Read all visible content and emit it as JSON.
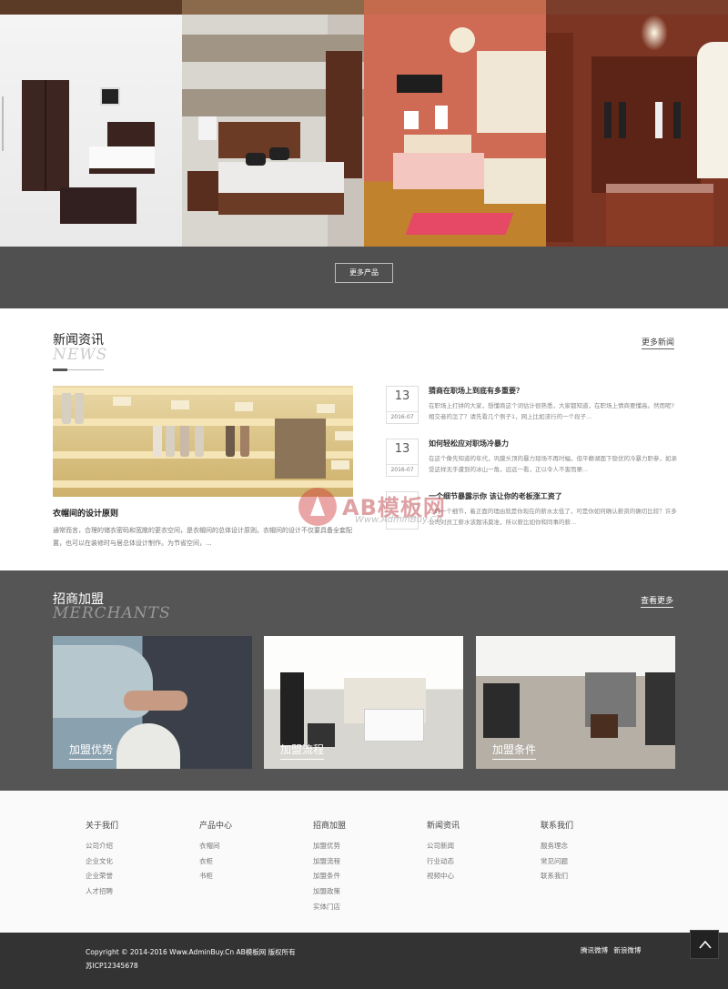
{
  "products": {
    "more_label": "更多产品"
  },
  "news": {
    "title_cn": "新闻资讯",
    "title_en": "NEWS",
    "more_label": "更多新闻",
    "featured": {
      "title": "衣帽间的设计原则",
      "desc": "通常而言，合理的储衣密码和宽敞的更衣空间，是衣帽间的总体设计原则。衣帽间的设计不仅要具备全套配置，也可以在装修时与居总体设计制作。为节省空间，..."
    },
    "items": [
      {
        "day": "13",
        "ym": "2016-07",
        "title": "猜商在职场上到底有多重要？",
        "desc": "在职场上打拼的大家，想懂商这个词估计很熟悉，大家都知道，在职场上情商要懂高。然而呢?相交者的怎了？请先看几个例子1，网上比如流行的一个段子..."
      },
      {
        "day": "13",
        "ym": "2016-07",
        "title": "如何轻松应对职场冷暴力",
        "desc": "在这个像先知道的年代，巩膜头顶的暴力现场不再时幅，但平静湖面下隐伏的冷暴力职参，如承受这样无手遭到的冰山一角，远远一看，正以令人不害而栗..."
      },
      {
        "day": "",
        "ym": "",
        "title": "一个细节暴露示你 该让你的老板涨工资了",
        "desc": "...的一个细节，着正面的理由就是你现在的薪水太低了，可是你如何确认薪资的确切比较？许多公司对员工薪水该题讳莫准，所以薪比如你和同事的薪..."
      }
    ]
  },
  "merchants": {
    "title_cn": "招商加盟",
    "title_en": "MERCHANTS",
    "more_label": "查看更多",
    "cards": [
      "加盟优势",
      "加盟流程",
      "加盟条件"
    ]
  },
  "watermark": {
    "text": "AB模板网",
    "url": "Www.AdminBuy.Cn"
  },
  "footer": {
    "columns": [
      {
        "title": "关于我们",
        "links": [
          "公司介绍",
          "企业文化",
          "企业荣誉",
          "人才招聘"
        ]
      },
      {
        "title": "产品中心",
        "links": [
          "衣帽间",
          "衣柜",
          "书柜"
        ]
      },
      {
        "title": "招商加盟",
        "links": [
          "加盟优势",
          "加盟流程",
          "加盟条件",
          "加盟政策",
          "实体门店"
        ]
      },
      {
        "title": "新闻资讯",
        "links": [
          "公司新闻",
          "行业动态",
          "视频中心"
        ]
      },
      {
        "title": "联系我们",
        "links": [
          "服务理念",
          "常见问题",
          "联系我们"
        ]
      }
    ],
    "copyright": "Copyright © 2014-2016 Www.AdminBuy.Cn AB模板网 版权所有",
    "icp": "苏ICP12345678",
    "social": [
      "腾讯微博",
      "新浪微博"
    ]
  },
  "colors": {
    "dark_band": "#505050",
    "merchants_bg": "#555555",
    "footer_bg": "#fafafa",
    "bottom_bar": "#333333"
  },
  "icons": {
    "back_to_top": "chevron-up-icon"
  }
}
